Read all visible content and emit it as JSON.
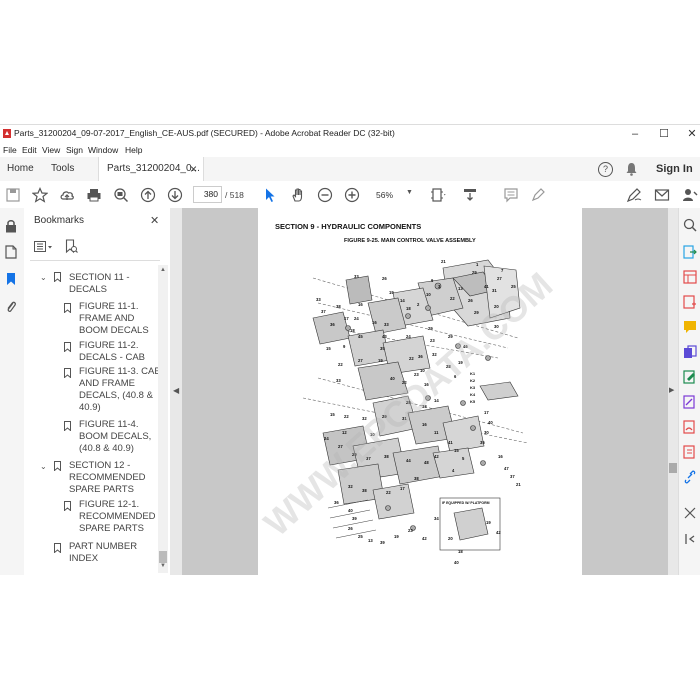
{
  "window": {
    "title": "Parts_31200204_09-07-2017_English_CE-AUS.pdf (SECURED) - Adobe Acrobat Reader DC (32-bit)",
    "minimize": "–",
    "maximize": "☐",
    "close": "✕"
  },
  "menu": [
    "File",
    "Edit",
    "View",
    "Sign",
    "Window",
    "Help"
  ],
  "tabs": {
    "home": "Home",
    "tools": "Tools",
    "document": "Parts_31200204_0...",
    "document_close": "×",
    "help_icon": "?",
    "sign_in": "Sign In"
  },
  "toolbar": {
    "page_current": "380",
    "page_total": "/ 518",
    "zoom": "56%"
  },
  "bookmarks": {
    "header": "Bookmarks",
    "close": "✕",
    "items": [
      {
        "label": "SECTION 11 -\nDECALS",
        "level": 0,
        "expanded": true
      },
      {
        "label": "FIGURE 11-1.\nFRAME AND\nBOOM DECALS",
        "level": 1
      },
      {
        "label": "FIGURE 11-2.\nDECALS - CAB",
        "level": 1
      },
      {
        "label": "FIGURE 11-3. CAB\nAND FRAME\nDECALS, (40.8 &\n40.9)",
        "level": 1
      },
      {
        "label": "FIGURE 11-4.\nBOOM DECALS,\n(40.8 & 40.9)",
        "level": 1
      },
      {
        "label": "SECTION 12 -\nRECOMMENDED\nSPARE PARTS",
        "level": 0,
        "expanded": true
      },
      {
        "label": "FIGURE 12-1.\nRECOMMENDED\nSPARE PARTS",
        "level": 1
      },
      {
        "label": "PART NUMBER\nINDEX",
        "level": 0
      }
    ]
  },
  "page": {
    "section_title": "SECTION 9 - HYDRAULIC COMPONENTS",
    "figure_title": "FIGURE 9-25. MAIN CONTROL VALVE ASSEMBLY",
    "inset_label": "IF EQUIPPED W/ PLATFORM",
    "watermark": "WWW.EPCDATA.COM",
    "kit_labels": [
      "K1",
      "K2",
      "K3",
      "K4",
      "K5"
    ],
    "callouts": [
      "21",
      "1",
      "7",
      "29",
      "27",
      "33",
      "26",
      "6",
      "3",
      "13",
      "41",
      "31",
      "22",
      "25",
      "19",
      "10",
      "26",
      "14",
      "2",
      "20",
      "29",
      "18",
      "30",
      "33",
      "38",
      "16",
      "37",
      "17",
      "16",
      "24",
      "36",
      "18",
      "33",
      "43",
      "35",
      "45",
      "9",
      "15",
      "29",
      "19",
      "27",
      "22",
      "29",
      "24",
      "23",
      "46",
      "22",
      "32",
      "28",
      "10",
      "33",
      "19",
      "6",
      "23",
      "15",
      "22",
      "32",
      "29",
      "31",
      "16",
      "11",
      "12",
      "10",
      "41",
      "15",
      "5",
      "4",
      "42",
      "48",
      "44",
      "38",
      "37",
      "29",
      "27",
      "24",
      "38",
      "17",
      "22",
      "38",
      "32",
      "36",
      "40",
      "39",
      "26",
      "25",
      "13",
      "39",
      "19",
      "23",
      "42",
      "34",
      "16",
      "47",
      "37",
      "21",
      "35",
      "30",
      "40",
      "17",
      "14",
      "33",
      "28",
      "16",
      "22",
      "36",
      "40",
      "20",
      "18",
      "40",
      "19",
      "42"
    ]
  },
  "colors": {
    "accent_blue": "#1473e6",
    "toolbar_bg": "#ffffff",
    "viewer_bg": "#c8c8c8",
    "pdf_red": "#d32f2f"
  }
}
